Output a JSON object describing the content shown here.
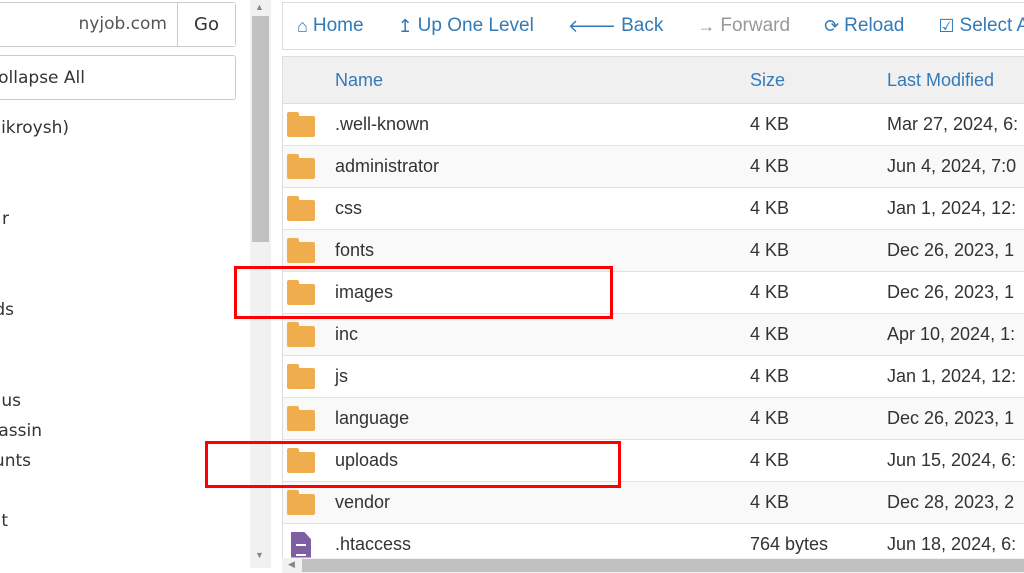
{
  "sidebar": {
    "address_value": "nyjob.com",
    "go_label": "Go",
    "collapse_label": "ollapse All",
    "tree_items": [
      "ikroysh)",
      "r",
      "ds",
      "us",
      "assin",
      "unts",
      "t"
    ]
  },
  "toolbar": {
    "items": [
      {
        "label": "Home",
        "icon": "home-icon"
      },
      {
        "label": "Up One Level",
        "icon": "level-up-icon"
      },
      {
        "label": "Back",
        "icon": "arrow-left-icon"
      },
      {
        "label": "Forward",
        "icon": "arrow-right-icon"
      },
      {
        "label": "Reload",
        "icon": "refresh-icon"
      },
      {
        "label": "Select A",
        "icon": "checkbox-icon"
      }
    ]
  },
  "table": {
    "headers": {
      "name": "Name",
      "size": "Size",
      "modified": "Last Modified"
    },
    "rows": [
      {
        "name": ".well-known",
        "size": "4 KB",
        "modified": "Mar 27, 2024, 6:",
        "type": "folder"
      },
      {
        "name": "administrator",
        "size": "4 KB",
        "modified": "Jun 4, 2024, 7:0",
        "type": "folder"
      },
      {
        "name": "css",
        "size": "4 KB",
        "modified": "Jan 1, 2024, 12:",
        "type": "folder"
      },
      {
        "name": "fonts",
        "size": "4 KB",
        "modified": "Dec 26, 2023, 1",
        "type": "folder"
      },
      {
        "name": "images",
        "size": "4 KB",
        "modified": "Dec 26, 2023, 1",
        "type": "folder"
      },
      {
        "name": "inc",
        "size": "4 KB",
        "modified": "Apr 10, 2024, 1:",
        "type": "folder"
      },
      {
        "name": "js",
        "size": "4 KB",
        "modified": "Jan 1, 2024, 12:",
        "type": "folder"
      },
      {
        "name": "language",
        "size": "4 KB",
        "modified": "Dec 26, 2023, 1",
        "type": "folder"
      },
      {
        "name": "uploads",
        "size": "4 KB",
        "modified": "Jun 15, 2024, 6:",
        "type": "folder"
      },
      {
        "name": "vendor",
        "size": "4 KB",
        "modified": "Dec 28, 2023, 2",
        "type": "folder"
      },
      {
        "name": ".htaccess",
        "size": "764 bytes",
        "modified": "Jun 18, 2024, 6:",
        "type": "file"
      }
    ]
  },
  "colors": {
    "accent": "#337ab7",
    "folder": "#f0ad4e",
    "highlight": "#ff0000",
    "file": "#7d5ea2"
  }
}
